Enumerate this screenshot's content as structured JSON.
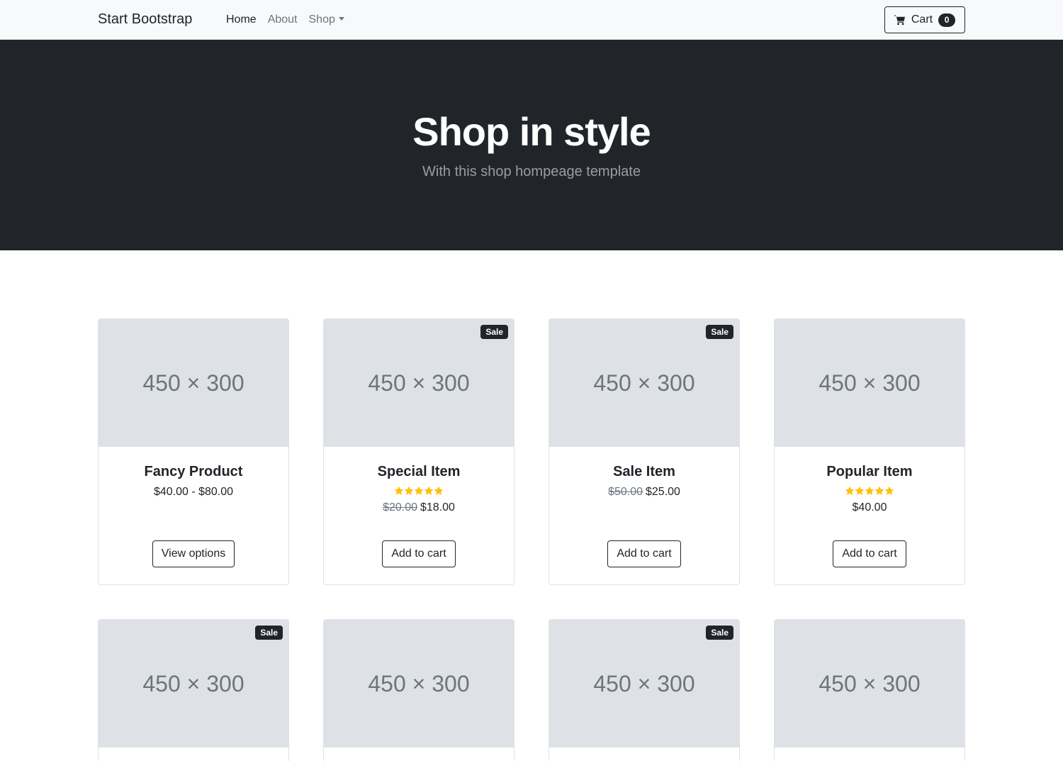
{
  "navbar": {
    "brand": "Start Bootstrap",
    "links": [
      {
        "label": "Home",
        "active": true
      },
      {
        "label": "About",
        "active": false
      },
      {
        "label": "Shop",
        "active": false,
        "dropdown": true
      }
    ],
    "cart": {
      "label": "Cart",
      "count": "0",
      "icon": "cart-icon"
    }
  },
  "hero": {
    "title": "Shop in style",
    "subtitle": "With this shop hompeage template"
  },
  "colors": {
    "dark": "#212529",
    "navbar_bg": "#f8f9fa",
    "placeholder_bg": "#dee2e6",
    "star": "#ffc107"
  },
  "products": [
    {
      "image_text": "450 × 300",
      "name": "Fancy Product",
      "sale": false,
      "rating": 0,
      "old_price": "",
      "price": "$40.00 - $80.00",
      "action": "View options"
    },
    {
      "image_text": "450 × 300",
      "name": "Special Item",
      "sale": true,
      "sale_label": "Sale",
      "rating": 5,
      "old_price": "$20.00",
      "price": "$18.00",
      "action": "Add to cart"
    },
    {
      "image_text": "450 × 300",
      "name": "Sale Item",
      "sale": true,
      "sale_label": "Sale",
      "rating": 0,
      "old_price": "$50.00",
      "price": "$25.00",
      "action": "Add to cart"
    },
    {
      "image_text": "450 × 300",
      "name": "Popular Item",
      "sale": false,
      "rating": 5,
      "old_price": "",
      "price": "$40.00",
      "action": "Add to cart"
    },
    {
      "image_text": "450 × 300",
      "sale": true,
      "sale_label": "Sale"
    },
    {
      "image_text": "450 × 300",
      "sale": false
    },
    {
      "image_text": "450 × 300",
      "sale": true,
      "sale_label": "Sale"
    },
    {
      "image_text": "450 × 300",
      "sale": false
    }
  ]
}
